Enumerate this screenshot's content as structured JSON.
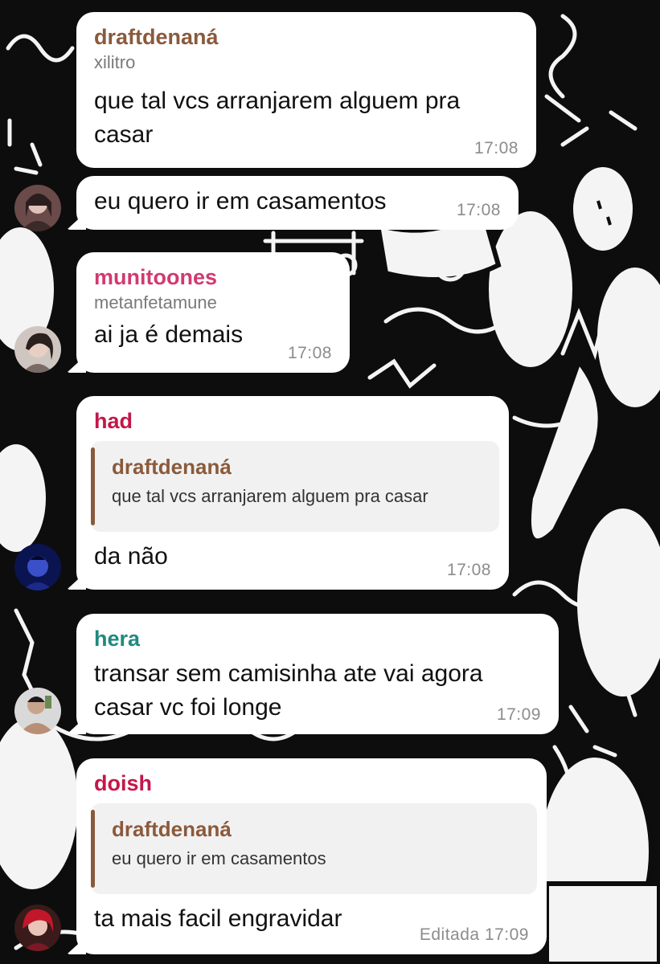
{
  "colors": {
    "draftdenana": "#8a5a3c",
    "munitoones": "#d03a70",
    "had": "#c4174a",
    "hera": "#1f8a7e",
    "doish": "#c4174a",
    "reply_bar": "#8a5a3c"
  },
  "messages": [
    {
      "sender": "draftdenaná",
      "handle": "xilitro",
      "text_lines": [
        "que tal vcs arranjarem alguem pra",
        "casar"
      ],
      "time": "17:08"
    },
    {
      "text_lines": [
        "eu quero ir em casamentos"
      ],
      "time": "17:08",
      "avatar_icon": "avatar-photo"
    },
    {
      "sender": "munitoones",
      "handle": "metanfetamune",
      "text_lines": [
        "ai ja é demais"
      ],
      "time": "17:08",
      "avatar_icon": "avatar-photo"
    },
    {
      "sender": "had",
      "reply": {
        "sender": "draftdenaná",
        "text": "que tal vcs arranjarem alguem pra casar"
      },
      "text_lines": [
        "da não"
      ],
      "time": "17:08",
      "avatar_icon": "avatar-photo"
    },
    {
      "sender": "hera",
      "text_lines": [
        "transar sem camisinha ate vai agora",
        "casar vc foi longe"
      ],
      "time": "17:09",
      "avatar_icon": "avatar-photo"
    },
    {
      "sender": "doish",
      "reply": {
        "sender": "draftdenaná",
        "text": "eu quero ir em casamentos"
      },
      "text_lines": [
        "ta mais facil engravidar"
      ],
      "edited": "Editada",
      "time": "17:09",
      "avatar_icon": "avatar-photo"
    }
  ]
}
